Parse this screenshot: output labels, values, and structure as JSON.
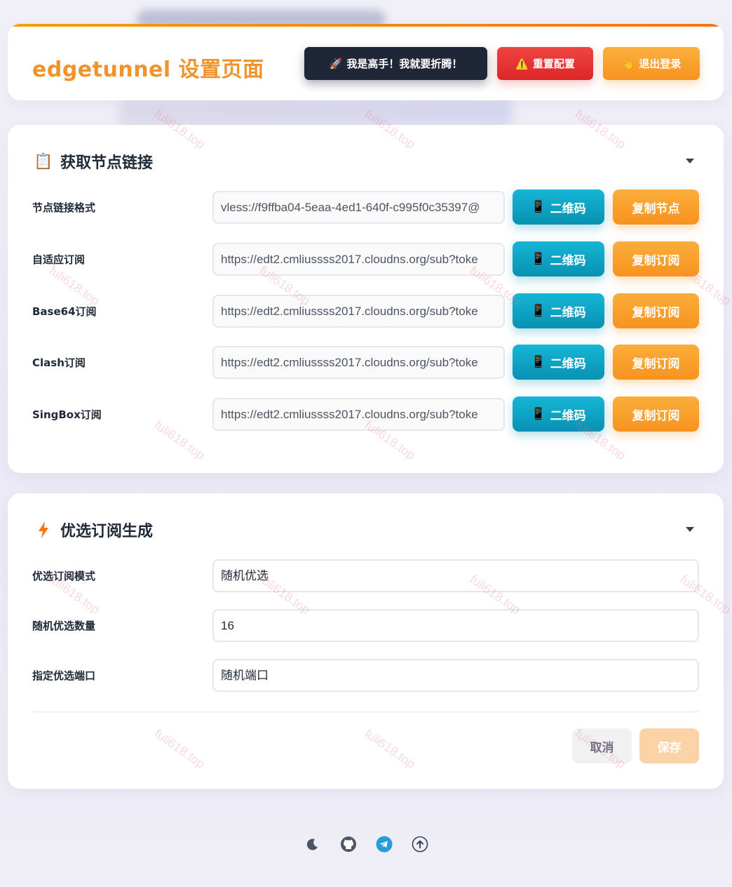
{
  "header": {
    "title": "edgetunnel 设置页面",
    "buttons": {
      "expert": "我是高手！我就要折腾！",
      "reset": "重置配置",
      "logout": "退出登录"
    }
  },
  "node_section": {
    "title": "获取节点链接",
    "rows": [
      {
        "label": "节点链接格式",
        "value": "vless://f9ffba04-5eaa-4ed1-640f-c995f0c35397@",
        "qr": "二维码",
        "copy": "复制节点"
      },
      {
        "label": "自适应订阅",
        "value": "https://edt2.cmliussss2017.cloudns.org/sub?toke",
        "qr": "二维码",
        "copy": "复制订阅"
      },
      {
        "label": "Base64订阅",
        "value": "https://edt2.cmliussss2017.cloudns.org/sub?toke",
        "qr": "二维码",
        "copy": "复制订阅"
      },
      {
        "label": "Clash订阅",
        "value": "https://edt2.cmliussss2017.cloudns.org/sub?toke",
        "qr": "二维码",
        "copy": "复制订阅"
      },
      {
        "label": "SingBox订阅",
        "value": "https://edt2.cmliussss2017.cloudns.org/sub?toke",
        "qr": "二维码",
        "copy": "复制订阅"
      }
    ]
  },
  "preferred_section": {
    "title": "优选订阅生成",
    "rows": [
      {
        "label": "优选订阅模式",
        "value": "随机优选"
      },
      {
        "label": "随机优选数量",
        "value": "16"
      },
      {
        "label": "指定优选端口",
        "value": "随机端口"
      }
    ],
    "cancel": "取消",
    "save": "保存"
  },
  "watermark": "fuli618.top",
  "colors": {
    "accent": "#f0932b",
    "dark_button": "#1e2637",
    "danger": "#dc2626",
    "cyan": "#0891b2",
    "orange": "#f7931e"
  },
  "footer": {
    "icons": [
      "moon-icon",
      "github-icon",
      "telegram-icon",
      "upload-icon"
    ]
  }
}
